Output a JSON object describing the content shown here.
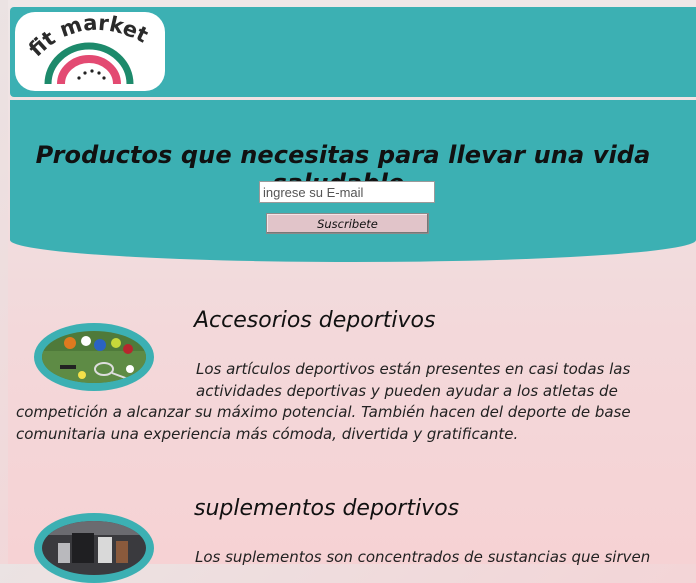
{
  "brand": {
    "name": "fit market",
    "colors": {
      "teal": "#3cb0b3",
      "pink": "#e34a72",
      "green": "#1d8a6b",
      "button": "#e1c4c9"
    }
  },
  "hero": {
    "title": "Productos que necesitas para llevar una vida saludable.",
    "email_placeholder": "ingrese su E-mail",
    "subscribe_label": "Suscribete"
  },
  "sections": [
    {
      "title": "Accesorios deportivos",
      "text": "Los artículos deportivos están presentes en casi todas las actividades deportivas y pueden ayudar a los atletas de competición a alcanzar su máximo potencial. También hacen del deporte de base comunitaria una experiencia más cómoda, divertida y gratificante."
    },
    {
      "title": "suplementos deportivos",
      "text": "Los suplementos son concentrados de sustancias que sirven"
    }
  ]
}
